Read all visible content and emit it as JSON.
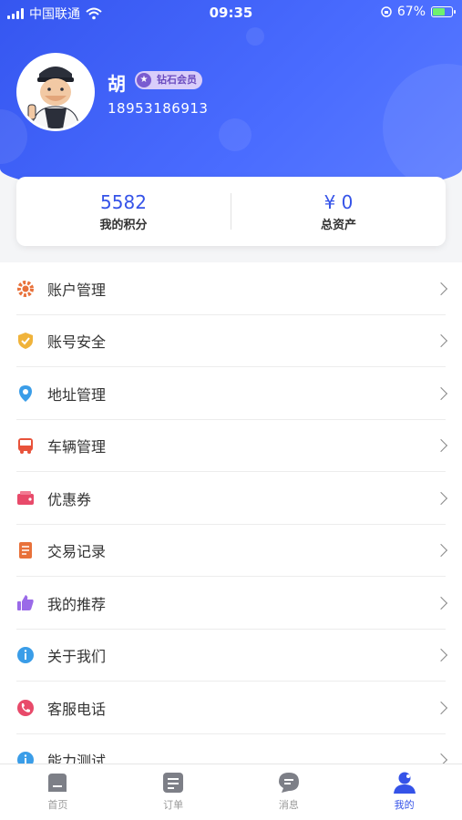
{
  "status": {
    "carrier": "中国联通",
    "time": "09:35",
    "battery": "67%",
    "battery_level": 0.67
  },
  "profile": {
    "name": "胡",
    "badge": "钻石会员",
    "phone": "18953186913"
  },
  "stats": [
    {
      "value": "5582",
      "label": "我的积分"
    },
    {
      "value": "¥ 0",
      "label": "总资产"
    }
  ],
  "menu": [
    {
      "label": "账户管理",
      "icon": "gear-icon",
      "color": "#e8713a"
    },
    {
      "label": "账号安全",
      "icon": "shield-icon",
      "color": "#f0b33a"
    },
    {
      "label": "地址管理",
      "icon": "location-pin-icon",
      "color": "#3a9de8"
    },
    {
      "label": "车辆管理",
      "icon": "bus-icon",
      "color": "#e8523a"
    },
    {
      "label": "优惠券",
      "icon": "coupon-icon",
      "color": "#e84a6a"
    },
    {
      "label": "交易记录",
      "icon": "receipt-icon",
      "color": "#e8713a"
    },
    {
      "label": "我的推荐",
      "icon": "thumbs-up-icon",
      "color": "#9a6ae8"
    },
    {
      "label": "关于我们",
      "icon": "info-icon",
      "color": "#3a9de8"
    },
    {
      "label": "客服电话",
      "icon": "phone-icon",
      "color": "#e84a6a"
    },
    {
      "label": "能力测试",
      "icon": "info-icon",
      "color": "#3a9de8"
    }
  ],
  "tabs": [
    {
      "label": "首页",
      "icon": "home-icon",
      "active": false
    },
    {
      "label": "订单",
      "icon": "order-icon",
      "active": false
    },
    {
      "label": "消息",
      "icon": "message-icon",
      "active": false
    },
    {
      "label": "我的",
      "icon": "user-icon",
      "active": true
    }
  ],
  "colors": {
    "accent": "#3553e8",
    "header": "#4262f5"
  }
}
